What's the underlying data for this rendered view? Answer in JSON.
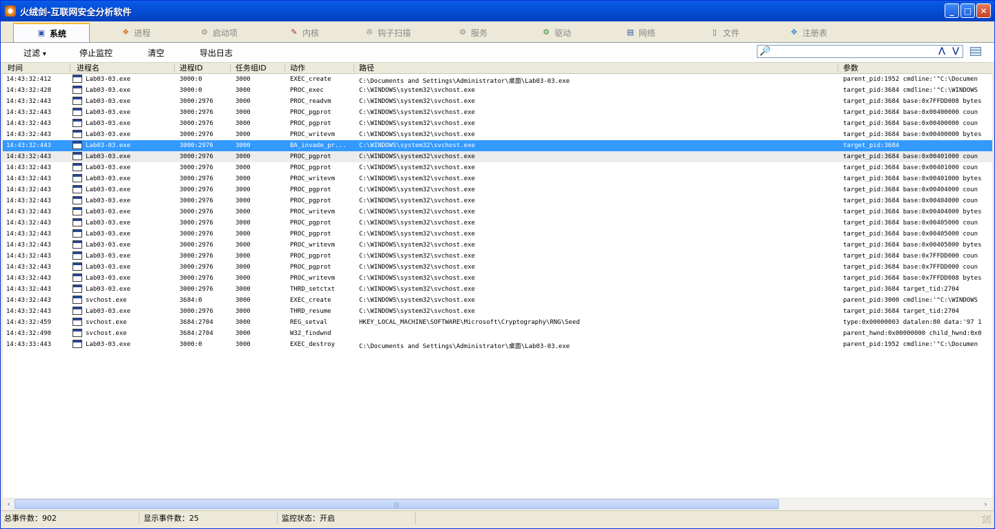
{
  "window": {
    "title": "火绒剑-互联网安全分析软件",
    "minimize": "_",
    "maximize": "□",
    "close": "✕"
  },
  "tabs": [
    {
      "label": "系统",
      "icon": "monitor-icon",
      "glyph": "▣"
    },
    {
      "label": "进程",
      "icon": "windows-flag-icon",
      "glyph": "❖"
    },
    {
      "label": "启动项",
      "icon": "gear-icon",
      "glyph": "⚙"
    },
    {
      "label": "内核",
      "icon": "kernel-icon",
      "glyph": "✎"
    },
    {
      "label": "钩子扫描",
      "icon": "hook-icon",
      "glyph": "✇"
    },
    {
      "label": "服务",
      "icon": "service-icon",
      "glyph": "⚙"
    },
    {
      "label": "驱动",
      "icon": "driver-icon",
      "glyph": "⚙"
    },
    {
      "label": "网络",
      "icon": "network-icon",
      "glyph": "▤"
    },
    {
      "label": "文件",
      "icon": "file-icon",
      "glyph": "▯"
    },
    {
      "label": "注册表",
      "icon": "registry-icon",
      "glyph": "✥"
    }
  ],
  "toolbar": {
    "filter": "过滤",
    "filter_caret": "▾",
    "stop": "停止监控",
    "clear": "清空",
    "export": "导出日志",
    "search_placeholder": "",
    "search_icon": "🔎",
    "up": "⋀",
    "down": "⋁"
  },
  "columns": [
    "时间",
    "进程名",
    "进程ID",
    "任务组ID",
    "动作",
    "路径",
    "参数"
  ],
  "rows": [
    {
      "time": "14:43:32:412",
      "proc": "Lab03-03.exe",
      "pid": "3000:0",
      "gid": "3000",
      "action": "EXEC_create",
      "path": "C:\\Documents and Settings\\Administrator\\桌面\\Lab03-03.exe",
      "param": "parent_pid:1952 cmdline:'\"C:\\Documen"
    },
    {
      "time": "14:43:32:428",
      "proc": "Lab03-03.exe",
      "pid": "3000:0",
      "gid": "3000",
      "action": "PROC_exec",
      "path": "C:\\WINDOWS\\system32\\svchost.exe",
      "param": "target_pid:3684 cmdline:'\"C:\\WINDOWS"
    },
    {
      "time": "14:43:32:443",
      "proc": "Lab03-03.exe",
      "pid": "3000:2976",
      "gid": "3000",
      "action": "PROC_readvm",
      "path": "C:\\WINDOWS\\system32\\svchost.exe",
      "param": "target_pid:3684 base:0x7FFDD008 bytes"
    },
    {
      "time": "14:43:32:443",
      "proc": "Lab03-03.exe",
      "pid": "3000:2976",
      "gid": "3000",
      "action": "PROC_pgprot",
      "path": "C:\\WINDOWS\\system32\\svchost.exe",
      "param": "target_pid:3684 base:0x00400000 coun"
    },
    {
      "time": "14:43:32:443",
      "proc": "Lab03-03.exe",
      "pid": "3000:2976",
      "gid": "3000",
      "action": "PROC_pgprot",
      "path": "C:\\WINDOWS\\system32\\svchost.exe",
      "param": "target_pid:3684 base:0x00400000 coun"
    },
    {
      "time": "14:43:32:443",
      "proc": "Lab03-03.exe",
      "pid": "3000:2976",
      "gid": "3000",
      "action": "PROC_writevm",
      "path": "C:\\WINDOWS\\system32\\svchost.exe",
      "param": "target_pid:3684 base:0x00400000 bytes"
    },
    {
      "time": "14:43:32:443",
      "proc": "Lab03-03.exe",
      "pid": "3000:2976",
      "gid": "3000",
      "action": "BA_invade_pr...",
      "path": "C:\\WINDOWS\\system32\\svchost.exe",
      "param": "target_pid:3684",
      "state": "selected"
    },
    {
      "time": "14:43:32:443",
      "proc": "Lab03-03.exe",
      "pid": "3000:2976",
      "gid": "3000",
      "action": "PROC_pgprot",
      "path": "C:\\WINDOWS\\system32\\svchost.exe",
      "param": "target_pid:3684 base:0x00401000 coun",
      "state": "hover"
    },
    {
      "time": "14:43:32:443",
      "proc": "Lab03-03.exe",
      "pid": "3000:2976",
      "gid": "3000",
      "action": "PROC_pgprot",
      "path": "C:\\WINDOWS\\system32\\svchost.exe",
      "param": "target_pid:3684 base:0x00401000 coun"
    },
    {
      "time": "14:43:32:443",
      "proc": "Lab03-03.exe",
      "pid": "3000:2976",
      "gid": "3000",
      "action": "PROC_writevm",
      "path": "C:\\WINDOWS\\system32\\svchost.exe",
      "param": "target_pid:3684 base:0x00401000 bytes"
    },
    {
      "time": "14:43:32:443",
      "proc": "Lab03-03.exe",
      "pid": "3000:2976",
      "gid": "3000",
      "action": "PROC_pgprot",
      "path": "C:\\WINDOWS\\system32\\svchost.exe",
      "param": "target_pid:3684 base:0x00404000 coun"
    },
    {
      "time": "14:43:32:443",
      "proc": "Lab03-03.exe",
      "pid": "3000:2976",
      "gid": "3000",
      "action": "PROC_pgprot",
      "path": "C:\\WINDOWS\\system32\\svchost.exe",
      "param": "target_pid:3684 base:0x00404000 coun"
    },
    {
      "time": "14:43:32:443",
      "proc": "Lab03-03.exe",
      "pid": "3000:2976",
      "gid": "3000",
      "action": "PROC_writevm",
      "path": "C:\\WINDOWS\\system32\\svchost.exe",
      "param": "target_pid:3684 base:0x00404000 bytes"
    },
    {
      "time": "14:43:32:443",
      "proc": "Lab03-03.exe",
      "pid": "3000:2976",
      "gid": "3000",
      "action": "PROC_pgprot",
      "path": "C:\\WINDOWS\\system32\\svchost.exe",
      "param": "target_pid:3684 base:0x00405000 coun"
    },
    {
      "time": "14:43:32:443",
      "proc": "Lab03-03.exe",
      "pid": "3000:2976",
      "gid": "3000",
      "action": "PROC_pgprot",
      "path": "C:\\WINDOWS\\system32\\svchost.exe",
      "param": "target_pid:3684 base:0x00405000 coun"
    },
    {
      "time": "14:43:32:443",
      "proc": "Lab03-03.exe",
      "pid": "3000:2976",
      "gid": "3000",
      "action": "PROC_writevm",
      "path": "C:\\WINDOWS\\system32\\svchost.exe",
      "param": "target_pid:3684 base:0x00405000 bytes"
    },
    {
      "time": "14:43:32:443",
      "proc": "Lab03-03.exe",
      "pid": "3000:2976",
      "gid": "3000",
      "action": "PROC_pgprot",
      "path": "C:\\WINDOWS\\system32\\svchost.exe",
      "param": "target_pid:3684 base:0x7FFDD000 coun"
    },
    {
      "time": "14:43:32:443",
      "proc": "Lab03-03.exe",
      "pid": "3000:2976",
      "gid": "3000",
      "action": "PROC_pgprot",
      "path": "C:\\WINDOWS\\system32\\svchost.exe",
      "param": "target_pid:3684 base:0x7FFDD000 coun"
    },
    {
      "time": "14:43:32:443",
      "proc": "Lab03-03.exe",
      "pid": "3000:2976",
      "gid": "3000",
      "action": "PROC_writevm",
      "path": "C:\\WINDOWS\\system32\\svchost.exe",
      "param": "target_pid:3684 base:0x7FFDD008 bytes"
    },
    {
      "time": "14:43:32:443",
      "proc": "Lab03-03.exe",
      "pid": "3000:2976",
      "gid": "3000",
      "action": "THRD_setctxt",
      "path": "C:\\WINDOWS\\system32\\svchost.exe",
      "param": "target_pid:3684 target_tid:2704"
    },
    {
      "time": "14:43:32:443",
      "proc": "svchost.exe",
      "pid": "3684:0",
      "gid": "3000",
      "action": "EXEC_create",
      "path": "C:\\WINDOWS\\system32\\svchost.exe",
      "param": "parent_pid:3000 cmdline:'\"C:\\WINDOWS"
    },
    {
      "time": "14:43:32:443",
      "proc": "Lab03-03.exe",
      "pid": "3000:2976",
      "gid": "3000",
      "action": "THRD_resume",
      "path": "C:\\WINDOWS\\system32\\svchost.exe",
      "param": "target_pid:3684 target_tid:2704"
    },
    {
      "time": "14:43:32:459",
      "proc": "svchost.exe",
      "pid": "3684:2704",
      "gid": "3000",
      "action": "REG_setval",
      "path": "HKEY_LOCAL_MACHINE\\SOFTWARE\\Microsoft\\Cryptography\\RNG\\Seed",
      "param": "type:0x00000003 datalen:80 data:'97 1"
    },
    {
      "time": "14:43:32:490",
      "proc": "svchost.exe",
      "pid": "3684:2704",
      "gid": "3000",
      "action": "W32_findwnd",
      "path": "",
      "param": "parent_hwnd:0x00000000 child_hwnd:0x0"
    },
    {
      "time": "14:43:33:443",
      "proc": "Lab03-03.exe",
      "pid": "3000:0",
      "gid": "3000",
      "action": "EXEC_destroy",
      "path": "C:\\Documents and Settings\\Administrator\\桌面\\Lab03-03.exe",
      "param": "parent_pid:1952 cmdline:'\"C:\\Documen"
    }
  ],
  "scrollbar": {
    "left": "‹",
    "right": "›",
    "grip": "|||"
  },
  "status": {
    "total": "总事件数：902",
    "shown": "显示事件数：25",
    "monitor": "监控状态：开启"
  },
  "colors": {
    "selected_row": "#3399ff",
    "titlebar": "#0450d8",
    "tab_accent": "#f8b830"
  }
}
